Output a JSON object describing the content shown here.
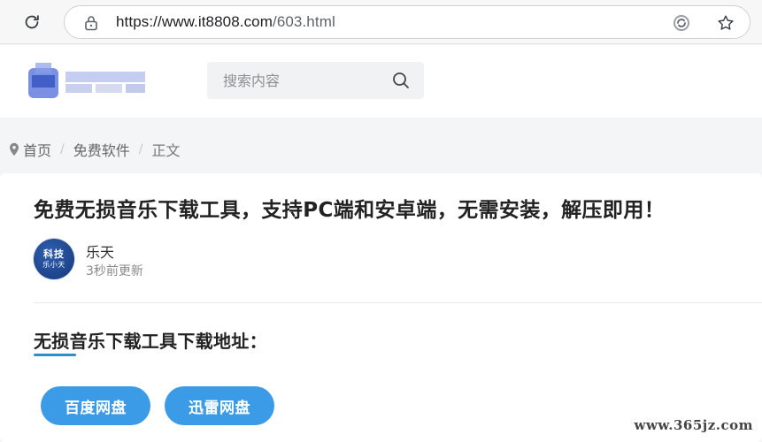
{
  "browser": {
    "url_host": "https://www.it8808.com",
    "url_path": "/603.html",
    "icons": [
      "reload-icon",
      "lock-icon",
      "reader-mode-icon",
      "star-icon"
    ]
  },
  "header": {
    "search_placeholder": "搜索内容",
    "icons": [
      "search-icon"
    ]
  },
  "breadcrumb": {
    "items": [
      "首页",
      "免费软件"
    ],
    "current": "正文",
    "icons": [
      "location-pin-icon"
    ]
  },
  "article": {
    "title": "免费无损音乐下载工具，支持PC端和安卓端，无需安装，解压即用！",
    "author": {
      "avatar_line1": "科技",
      "avatar_line2": "乐小天",
      "name": "乐天",
      "updated": "3秒前更新"
    },
    "section_heading": "无损音乐下载工具下载地址：",
    "buttons": [
      "百度网盘",
      "迅雷网盘"
    ]
  },
  "watermark": "www.365jz.com",
  "colors": {
    "accent": "#3b9be6",
    "underline": "#2c8ecf",
    "avatar": "#1e4590",
    "page_bg": "#f4f5f7"
  }
}
